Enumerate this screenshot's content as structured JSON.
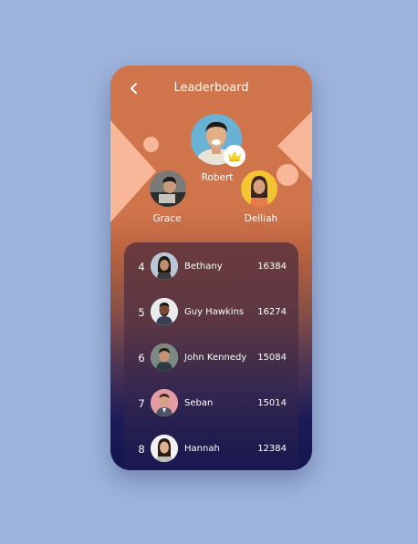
{
  "header": {
    "title": "Leaderboard",
    "back_icon": "chevron-left-icon"
  },
  "podium": {
    "first": {
      "name": "Robert",
      "badge_icon": "crown-icon"
    },
    "second": {
      "name": "Grace"
    },
    "third": {
      "name": "Delliah"
    }
  },
  "leaderboard": [
    {
      "rank": "4",
      "name": "Bethany",
      "score": "16384"
    },
    {
      "rank": "5",
      "name": "Guy Hawkins",
      "score": "16274"
    },
    {
      "rank": "6",
      "name": "John Kennedy",
      "score": "15084"
    },
    {
      "rank": "7",
      "name": "Seban",
      "score": "15014"
    },
    {
      "rank": "8",
      "name": "Hannah",
      "score": "12384"
    }
  ],
  "colors": {
    "background": "#9db3dc",
    "header_orange": "#d0744c",
    "accent_peach": "#f7b798",
    "deep_navy": "#14154f",
    "crown_yellow": "#f6d22c"
  }
}
